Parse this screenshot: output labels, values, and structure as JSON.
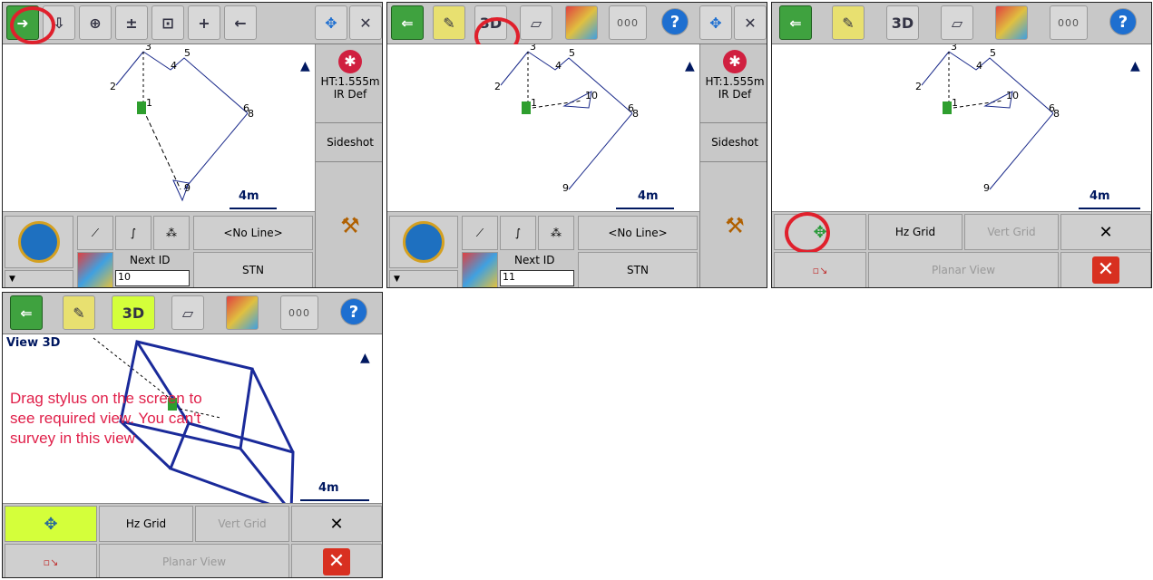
{
  "panels": {
    "p1": {
      "toolbar": {
        "zoom_plus": "±"
      },
      "right": {
        "height": "HT:1.555m",
        "prism": "IR Def",
        "sideshot": "Sideshot"
      },
      "bottom": {
        "line": "<No Line>",
        "next_id_label": "Next ID",
        "next_id_value": "10",
        "stn": "STN"
      },
      "scale": "4m",
      "points": [
        "1",
        "2",
        "3",
        "4",
        "5",
        "6",
        "8",
        "9"
      ]
    },
    "p2": {
      "toolbar": {
        "view3d": "3D"
      },
      "right": {
        "height": "HT:1.555m",
        "prism": "IR Def",
        "sideshot": "Sideshot"
      },
      "bottom": {
        "line": "<No Line>",
        "next_id_label": "Next ID",
        "next_id_value": "11",
        "stn": "STN"
      },
      "scale": "4m",
      "points": [
        "1",
        "2",
        "3",
        "4",
        "5",
        "6",
        "8",
        "9",
        "10"
      ]
    },
    "p3": {
      "toolbar": {
        "view3d": "3D"
      },
      "bottom": {
        "hz_grid": "Hz Grid",
        "vert_grid": "Vert Grid",
        "planar_view": "Planar View"
      },
      "scale": "4m",
      "points": [
        "1",
        "2",
        "3",
        "4",
        "5",
        "6",
        "8",
        "9",
        "10"
      ]
    },
    "p4": {
      "toolbar": {
        "view3d": "3D"
      },
      "view_title": "View 3D",
      "instruction": "Drag stylus on the screen to see required view. You can't survey in this view",
      "bottom": {
        "hz_grid": "Hz Grid",
        "vert_grid": "Vert Grid",
        "planar_view": "Planar View"
      },
      "scale": "4m"
    }
  },
  "icons": [
    "exit-arrow-icon",
    "fit-icon",
    "zoom-plus-minus-icon",
    "zoom-window-icon",
    "zoom-in-icon",
    "back-arrow-icon",
    "pan-icon",
    "tools-icon",
    "layers-icon",
    "3d-view-icon",
    "map-color-icon",
    "keypad-icon",
    "help-icon",
    "north-arrow-icon",
    "instrument-icon",
    "prism-icon",
    "close-icon"
  ],
  "colors": {
    "highlight_circle": "#e0202c",
    "active_button": "#d4ff3a",
    "instruction_text": "#e0204a"
  }
}
